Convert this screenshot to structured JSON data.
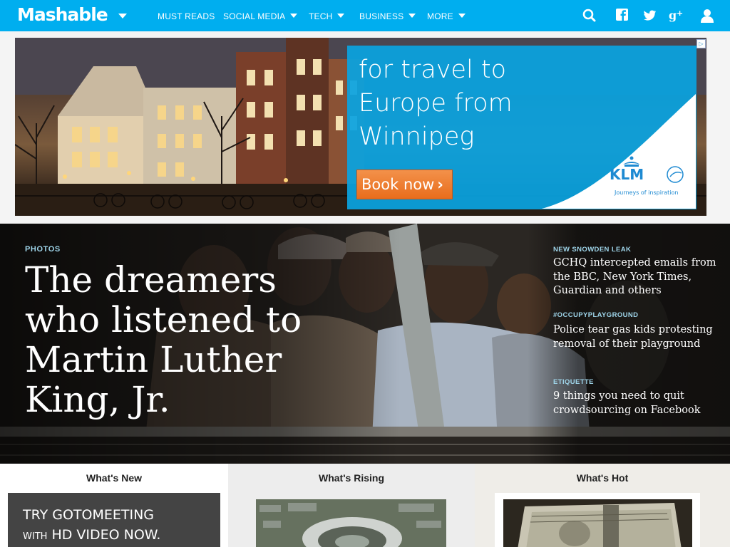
{
  "nav": {
    "logo": "Mashable",
    "items": [
      {
        "label": "MUST READS",
        "dropdown": false
      },
      {
        "label": "SOCIAL MEDIA",
        "dropdown": true
      },
      {
        "label": "TECH",
        "dropdown": true
      },
      {
        "label": "BUSINESS",
        "dropdown": true
      },
      {
        "label": "MORE",
        "dropdown": true
      }
    ],
    "icons": [
      "search-icon",
      "facebook-icon",
      "twitter-icon",
      "google-plus-icon",
      "user-icon"
    ],
    "bg_color": "#00aeef"
  },
  "ad": {
    "headline": "for travel to Europe from Winnipeg",
    "cta": "Book now",
    "brand": "KLM",
    "tagline": "Journeys of inspiration",
    "accent": "#0aa3e0",
    "cta_color": "#e86d1c"
  },
  "hero": {
    "tag": "PHOTOS",
    "title": "The dreamers who listened to Martin Luther King, Jr."
  },
  "side_stories": [
    {
      "tag": "NEW SNOWDEN LEAK",
      "title": "GCHQ intercepted emails from the BBC, New York Times, Guardian and others"
    },
    {
      "tag": "#OCCUPYPLAYGROUND",
      "title": "Police tear gas kids protesting removal of their playground"
    },
    {
      "tag": "ETIQUETTE",
      "title": "9 things you need to quit crowdsourcing on Facebook"
    }
  ],
  "columns": {
    "new": {
      "heading": "What's New",
      "promo_line1": "TRY GOTOMEETING",
      "promo_line2_small": "WITH",
      "promo_line2": "HD VIDEO NOW."
    },
    "rising": {
      "heading": "What's Rising"
    },
    "hot": {
      "heading": "What's Hot"
    }
  }
}
